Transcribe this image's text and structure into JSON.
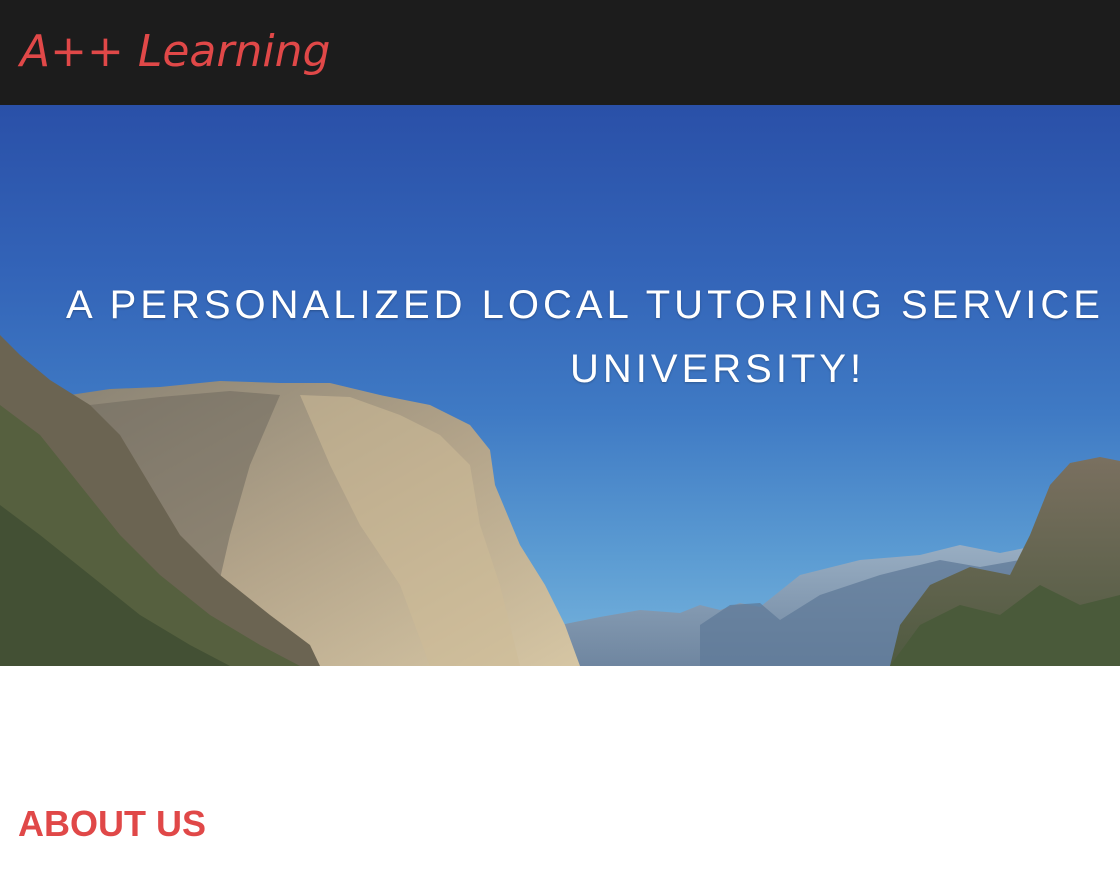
{
  "navbar": {
    "brand": "A++ Learning",
    "background": "#1c1c1c",
    "brand_color": "#e04848"
  },
  "hero": {
    "headline_line1": "A PERSONALIZED LOCAL TUTORING SERVICE",
    "headline_line2": "UNIVERSITY!",
    "text_color": "#ffffff"
  },
  "about": {
    "title": "ABOUT US",
    "title_color": "#e04848"
  }
}
